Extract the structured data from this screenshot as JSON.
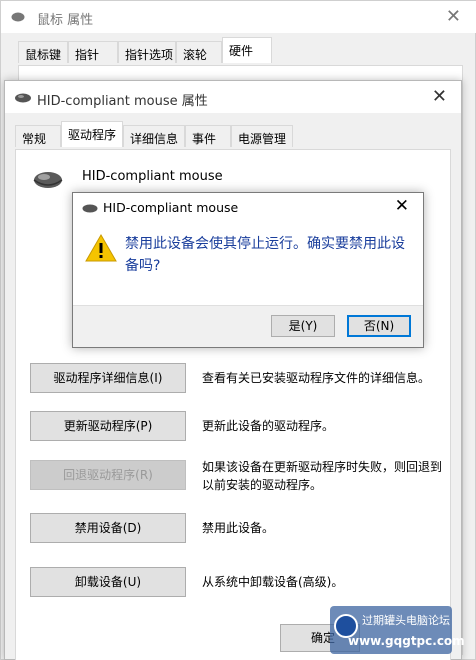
{
  "back_window": {
    "title": "鼠标 属性",
    "tabs": [
      "鼠标键",
      "指针",
      "指针选项",
      "滚轮",
      "硬件"
    ],
    "active_tab": "硬件"
  },
  "front_window": {
    "title": "HID-compliant mouse 属性",
    "tabs": [
      "常规",
      "驱动程序",
      "详细信息",
      "事件",
      "电源管理"
    ],
    "active_tab": "驱动程序",
    "device_name": "HID-compliant mouse",
    "actions": [
      {
        "label": "驱动程序详细信息(I)",
        "desc": "查看有关已安装驱动程序文件的详细信息。",
        "disabled": false
      },
      {
        "label": "更新驱动程序(P)",
        "desc": "更新此设备的驱动程序。",
        "disabled": false
      },
      {
        "label": "回退驱动程序(R)",
        "desc": "如果该设备在更新驱动程序时失败，则回退到以前安装的驱动程序。",
        "disabled": true
      },
      {
        "label": "禁用设备(D)",
        "desc": "禁用此设备。",
        "disabled": false
      },
      {
        "label": "卸载设备(U)",
        "desc": "从系统中卸载设备(高级)。",
        "disabled": false
      }
    ],
    "ok_label": "确定"
  },
  "dialog": {
    "title": "HID-compliant mouse",
    "message": "禁用此设备会使其停止运行。确实要禁用此设备吗?",
    "yes_label": "是(Y)",
    "no_label": "否(N)"
  },
  "watermark": {
    "line1": "过期罐头电脑论坛",
    "line2": "www.gqgtpc.com"
  },
  "colors": {
    "message_text": "#1a3e9c",
    "focus_border": "#0078d7",
    "warning_yellow": "#f5c400"
  },
  "icons": {
    "close": "close-icon",
    "mouse": "mouse-icon",
    "warning": "warning-icon"
  }
}
